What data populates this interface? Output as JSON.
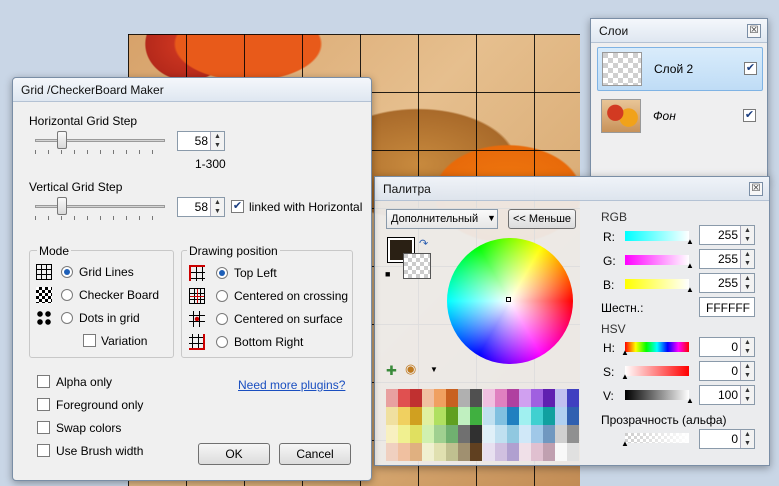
{
  "grid_dialog": {
    "title": "Grid /CheckerBoard Maker",
    "horizontal_label": "Horizontal Grid Step",
    "horizontal_value": "58",
    "horizontal_range": "1-300",
    "vertical_label": "Vertical Grid Step",
    "vertical_value": "58",
    "linked_label": "linked with Horizontal",
    "linked_checked": true,
    "mode_title": "Mode",
    "mode_options": [
      "Grid Lines",
      "Checker Board",
      "Dots in grid"
    ],
    "variation_label": "Variation",
    "drawing_title": "Drawing position",
    "drawing_options": [
      "Top Left",
      "Centered on crossing",
      "Centered on surface",
      "Bottom Right"
    ],
    "alpha_only": "Alpha only",
    "foreground_only": "Foreground only",
    "swap_colors": "Swap colors",
    "use_brush_width": "Use Brush width",
    "plugins_link": "Need more plugins?",
    "ok": "OK",
    "cancel": "Cancel"
  },
  "layers": {
    "title": "Слои",
    "close": "☒",
    "items": [
      {
        "name": "Слой 2",
        "visible": true,
        "selected": true
      },
      {
        "name": "Фон",
        "visible": true,
        "selected": false
      }
    ]
  },
  "palette": {
    "title": "Палитра",
    "close": "☒",
    "mode_select": "Дополнительный",
    "less_button": "<< Меньше",
    "rgb_title": "RGB",
    "r_label": "R:",
    "r_value": "255",
    "g_label": "G:",
    "g_value": "255",
    "b_label": "B:",
    "b_value": "255",
    "hex_label": "Шестн.:",
    "hex_value": "FFFFFF",
    "hsv_title": "HSV",
    "h_label": "H:",
    "h_value": "0",
    "s_label": "S:",
    "s_value": "0",
    "v_label": "V:",
    "v_value": "100",
    "alpha_label": "Прозрачность (альфа)",
    "alpha_value": "0",
    "primary_color": "#2a2014",
    "secondary_color": "#ffffff"
  }
}
